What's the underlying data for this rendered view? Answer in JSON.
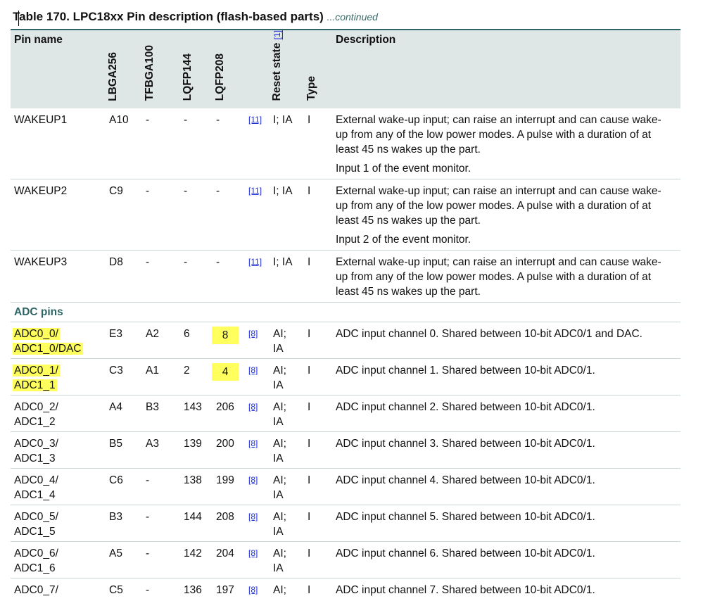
{
  "caption": {
    "title": "Table 170.  LPC18xx Pin description (flash-based parts)",
    "continued": "...continued"
  },
  "columns": {
    "pin_name": "Pin name",
    "lbga256": "LBGA256",
    "tfbga100": "TFBGA100",
    "lqfp144": "LQFP144",
    "lqfp208": "LQFP208",
    "reset_state": "Reset state",
    "reset_state_ref": "[1]",
    "type": "Type",
    "description": "Description"
  },
  "rows_wakeup": [
    {
      "pin": "WAKEUP1",
      "lbga": "A10",
      "tfbga": "-",
      "lqfp144": "-",
      "lqfp208": "-",
      "ref": "[11]",
      "reset": "I; IA",
      "type": "I",
      "desc1": "External wake-up input; can raise an interrupt and can cause wake-up from any of the low power modes. A pulse with a duration of at least 45 ns wakes up the part.",
      "desc2": "Input 1 of the event monitor."
    },
    {
      "pin": "WAKEUP2",
      "lbga": "C9",
      "tfbga": "-",
      "lqfp144": "-",
      "lqfp208": "-",
      "ref": "[11]",
      "reset": "I; IA",
      "type": "I",
      "desc1": "External wake-up input; can raise an interrupt and can cause wake-up from any of the low power modes. A pulse with a duration of at least  45 ns wakes up the part.",
      "desc2": "Input 2 of the event monitor."
    },
    {
      "pin": "WAKEUP3",
      "lbga": "D8",
      "tfbga": "-",
      "lqfp144": "-",
      "lqfp208": "-",
      "ref": "[11]",
      "reset": "I; IA",
      "type": "I",
      "desc1": "External wake-up input; can raise an interrupt and can cause wake-up from any of the low power modes. A pulse with a duration of at least  45 ns wakes up the part."
    }
  ],
  "section_adc": "ADC pins",
  "rows_adc": [
    {
      "pin1": "ADC0_0/",
      "pin2": "ADC1_0/DAC",
      "lbga": "E3",
      "tfbga": "A2",
      "lqfp144": "6",
      "lqfp208": "8",
      "ref": "[8]",
      "reset1": "AI;",
      "reset2": "IA",
      "type": "I",
      "desc": "ADC input channel 0. Shared between 10-bit ADC0/1 and DAC."
    },
    {
      "pin1": "ADC0_1/",
      "pin2": "ADC1_1",
      "lbga": "C3",
      "tfbga": "A1",
      "lqfp144": "2",
      "lqfp208": "4",
      "ref": "[8]",
      "reset1": "AI;",
      "reset2": "IA",
      "type": "I",
      "desc": "ADC input channel 1. Shared between 10-bit ADC0/1."
    },
    {
      "pin1": "ADC0_2/",
      "pin2": "ADC1_2",
      "lbga": "A4",
      "tfbga": "B3",
      "lqfp144": "143",
      "lqfp208": "206",
      "ref": "[8]",
      "reset1": "AI;",
      "reset2": "IA",
      "type": "I",
      "desc": "ADC input channel 2. Shared between 10-bit ADC0/1."
    },
    {
      "pin1": "ADC0_3/",
      "pin2": "ADC1_3",
      "lbga": "B5",
      "tfbga": "A3",
      "lqfp144": "139",
      "lqfp208": "200",
      "ref": "[8]",
      "reset1": "AI;",
      "reset2": "IA",
      "type": "I",
      "desc": "ADC input channel 3. Shared between 10-bit ADC0/1."
    },
    {
      "pin1": "ADC0_4/",
      "pin2": "ADC1_4",
      "lbga": "C6",
      "tfbga": "-",
      "lqfp144": "138",
      "lqfp208": "199",
      "ref": "[8]",
      "reset1": "AI;",
      "reset2": "IA",
      "type": "I",
      "desc": "ADC input channel 4. Shared between 10-bit ADC0/1."
    },
    {
      "pin1": "ADC0_5/",
      "pin2": "ADC1_5",
      "lbga": "B3",
      "tfbga": "-",
      "lqfp144": "144",
      "lqfp208": "208",
      "ref": "[8]",
      "reset1": "AI;",
      "reset2": "IA",
      "type": "I",
      "desc": "ADC input channel 5. Shared between 10-bit ADC0/1."
    },
    {
      "pin1": "ADC0_6/",
      "pin2": "ADC1_6",
      "lbga": "A5",
      "tfbga": "-",
      "lqfp144": "142",
      "lqfp208": "204",
      "ref": "[8]",
      "reset1": "AI;",
      "reset2": "IA",
      "type": "I",
      "desc": "ADC input channel 6. Shared between 10-bit ADC0/1."
    },
    {
      "pin1": "ADC0_7/",
      "pin2": "",
      "lbga": "C5",
      "tfbga": "-",
      "lqfp144": "136",
      "lqfp208": "197",
      "ref": "[8]",
      "reset1": "AI;",
      "reset2": "",
      "type": "I",
      "desc": "ADC input channel 7. Shared between 10-bit ADC0/1."
    }
  ],
  "highlight_color": "#ffff5e",
  "accent_color": "#2e6566"
}
